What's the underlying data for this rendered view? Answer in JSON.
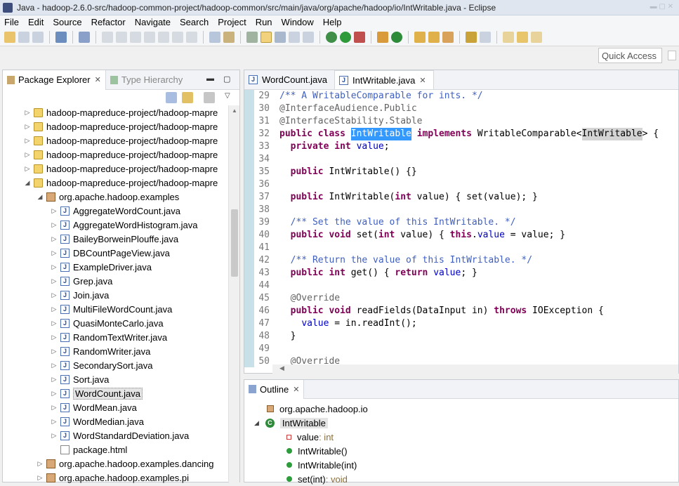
{
  "window": {
    "title": "Java - hadoop-2.6.0-src/hadoop-common-project/hadoop-common/src/main/java/org/apache/hadoop/io/IntWritable.java - Eclipse"
  },
  "menu": [
    "File",
    "Edit",
    "Source",
    "Refactor",
    "Navigate",
    "Search",
    "Project",
    "Run",
    "Window",
    "Help"
  ],
  "quick_access": {
    "placeholder": "Quick Access"
  },
  "package_explorer": {
    "tab_label": "Package Explorer",
    "tab2_label": "Type Hierarchy",
    "projects": [
      "hadoop-mapreduce-project/hadoop-mapre",
      "hadoop-mapreduce-project/hadoop-mapre",
      "hadoop-mapreduce-project/hadoop-mapre",
      "hadoop-mapreduce-project/hadoop-mapre",
      "hadoop-mapreduce-project/hadoop-mapre",
      "hadoop-mapreduce-project/hadoop-mapre"
    ],
    "package": "org.apache.hadoop.examples",
    "files": [
      "AggregateWordCount.java",
      "AggregateWordHistogram.java",
      "BaileyBorweinPlouffe.java",
      "DBCountPageView.java",
      "ExampleDriver.java",
      "Grep.java",
      "Join.java",
      "MultiFileWordCount.java",
      "QuasiMonteCarlo.java",
      "RandomTextWriter.java",
      "RandomWriter.java",
      "SecondarySort.java",
      "Sort.java",
      "WordCount.java",
      "WordMean.java",
      "WordMedian.java",
      "WordStandardDeviation.java"
    ],
    "html_file": "package.html",
    "package2": "org.apache.hadoop.examples.dancing",
    "package3": "org.apache.hadoop.examples.pi"
  },
  "editor": {
    "tabs": [
      "WordCount.java",
      "IntWritable.java"
    ],
    "lines": [
      {
        "n": "29",
        "segs": [
          [
            "c",
            "/** A WritableComparable for "
          ],
          [
            "c",
            "ints"
          ],
          [
            "c",
            ". */"
          ]
        ]
      },
      {
        "n": "30",
        "segs": [
          [
            "a",
            "@InterfaceAudience."
          ],
          [
            "a",
            "Public"
          ]
        ]
      },
      {
        "n": "31",
        "segs": [
          [
            "a",
            "@InterfaceStability."
          ],
          [
            "a",
            "Stable"
          ]
        ]
      },
      {
        "n": "32",
        "segs": [
          [
            "k",
            "public"
          ],
          [
            "t",
            " "
          ],
          [
            "k",
            "class"
          ],
          [
            "t",
            " "
          ],
          [
            "s",
            "IntWritable"
          ],
          [
            "t",
            " "
          ],
          [
            "k",
            "implements"
          ],
          [
            "t",
            " WritableComparable<"
          ],
          [
            "o",
            "IntWritable"
          ],
          [
            "t",
            "> {"
          ]
        ]
      },
      {
        "n": "33",
        "segs": [
          [
            "t",
            "  "
          ],
          [
            "k",
            "private"
          ],
          [
            "t",
            " "
          ],
          [
            "k",
            "int"
          ],
          [
            "t",
            " "
          ],
          [
            "f",
            "value"
          ],
          [
            "t",
            ";"
          ]
        ]
      },
      {
        "n": "34",
        "segs": []
      },
      {
        "n": "35",
        "segs": [
          [
            "t",
            "  "
          ],
          [
            "k",
            "public"
          ],
          [
            "t",
            " IntWritable() {}"
          ]
        ]
      },
      {
        "n": "36",
        "segs": []
      },
      {
        "n": "37",
        "segs": [
          [
            "t",
            "  "
          ],
          [
            "k",
            "public"
          ],
          [
            "t",
            " IntWritable("
          ],
          [
            "k",
            "int"
          ],
          [
            "t",
            " value) { set(value); }"
          ]
        ]
      },
      {
        "n": "38",
        "segs": []
      },
      {
        "n": "39",
        "segs": [
          [
            "t",
            "  "
          ],
          [
            "c",
            "/** Set the value of this IntWritable. */"
          ]
        ]
      },
      {
        "n": "40",
        "segs": [
          [
            "t",
            "  "
          ],
          [
            "k",
            "public"
          ],
          [
            "t",
            " "
          ],
          [
            "k",
            "void"
          ],
          [
            "t",
            " set("
          ],
          [
            "k",
            "int"
          ],
          [
            "t",
            " value) { "
          ],
          [
            "k",
            "this"
          ],
          [
            "t",
            "."
          ],
          [
            "f",
            "value"
          ],
          [
            "t",
            " = value; }"
          ]
        ]
      },
      {
        "n": "41",
        "segs": []
      },
      {
        "n": "42",
        "segs": [
          [
            "t",
            "  "
          ],
          [
            "c",
            "/** Return the value of this IntWritable. */"
          ]
        ]
      },
      {
        "n": "43",
        "segs": [
          [
            "t",
            "  "
          ],
          [
            "k",
            "public"
          ],
          [
            "t",
            " "
          ],
          [
            "k",
            "int"
          ],
          [
            "t",
            " get() { "
          ],
          [
            "k",
            "return"
          ],
          [
            "t",
            " "
          ],
          [
            "f",
            "value"
          ],
          [
            "t",
            "; }"
          ]
        ]
      },
      {
        "n": "44",
        "segs": []
      },
      {
        "n": "45",
        "segs": [
          [
            "t",
            "  "
          ],
          [
            "a",
            "@Override"
          ]
        ]
      },
      {
        "n": "46",
        "segs": [
          [
            "t",
            "  "
          ],
          [
            "k",
            "public"
          ],
          [
            "t",
            " "
          ],
          [
            "k",
            "void"
          ],
          [
            "t",
            " readFields(DataInput in) "
          ],
          [
            "k",
            "throws"
          ],
          [
            "t",
            " IOException {"
          ]
        ]
      },
      {
        "n": "47",
        "segs": [
          [
            "t",
            "    "
          ],
          [
            "f",
            "value"
          ],
          [
            "t",
            " = in.readInt();"
          ]
        ]
      },
      {
        "n": "48",
        "segs": [
          [
            "t",
            "  }"
          ]
        ]
      },
      {
        "n": "49",
        "segs": []
      },
      {
        "n": "50",
        "segs": [
          [
            "t",
            "  "
          ],
          [
            "a",
            "@Override"
          ]
        ]
      }
    ]
  },
  "outline": {
    "tab_label": "Outline",
    "items": [
      {
        "label": "org.apache.hadoop.io",
        "meta": "",
        "kind": "package"
      },
      {
        "label": "IntWritable",
        "meta": "",
        "kind": "class"
      },
      {
        "label": "value",
        "meta": " : int",
        "kind": "field"
      },
      {
        "label": "IntWritable()",
        "meta": "",
        "kind": "ctor"
      },
      {
        "label": "IntWritable(int)",
        "meta": "",
        "kind": "ctor"
      },
      {
        "label": "set(int)",
        "meta": " : void",
        "kind": "method"
      }
    ]
  }
}
